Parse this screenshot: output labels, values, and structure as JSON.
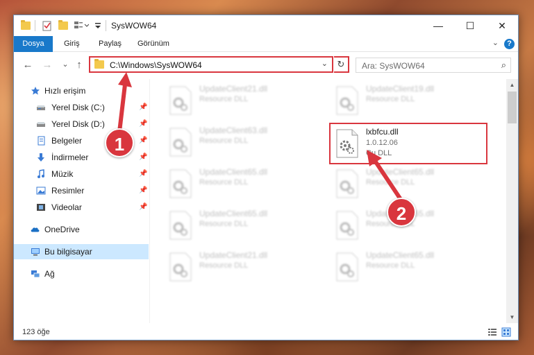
{
  "window": {
    "title": "SysWOW64",
    "minimize_glyph": "—",
    "maximize_glyph": "☐",
    "close_glyph": "✕"
  },
  "ribbon": {
    "tabs": [
      "Dosya",
      "Giriş",
      "Paylaş",
      "Görünüm"
    ],
    "help_glyph": "?",
    "expand_glyph": "⌄"
  },
  "nav": {
    "back_glyph": "←",
    "forward_glyph": "→",
    "recent_glyph": "⌄",
    "up_glyph": "↑",
    "address_path": "C:\\Windows\\SysWOW64",
    "address_dropdown_glyph": "⌄",
    "refresh_glyph": "↻",
    "search_placeholder": "Ara: SysWOW64",
    "search_glyph": "⌕"
  },
  "sidebar": {
    "pin_glyph": "📌",
    "items": [
      {
        "label": "Hızlı erişim",
        "icon": "star-icon"
      },
      {
        "label": "Yerel Disk (C:)",
        "icon": "drive-icon",
        "pinned": true
      },
      {
        "label": "Yerel Disk (D:)",
        "icon": "drive-icon",
        "pinned": true
      },
      {
        "label": "Belgeler",
        "icon": "documents-icon",
        "pinned": true
      },
      {
        "label": "İndirmeler",
        "icon": "download-icon",
        "pinned": true
      },
      {
        "label": "Müzik",
        "icon": "music-icon",
        "pinned": true
      },
      {
        "label": "Resimler",
        "icon": "pictures-icon",
        "pinned": true
      },
      {
        "label": "Videolar",
        "icon": "videos-icon",
        "pinned": true
      },
      {
        "label": "OneDrive",
        "icon": "cloud-icon"
      },
      {
        "label": "Bu bilgisayar",
        "icon": "computer-icon",
        "selected": true
      },
      {
        "label": "Ağ",
        "icon": "network-icon"
      }
    ]
  },
  "files": {
    "left_column": [
      {
        "name": "UpdateClient21.dll",
        "type": "Resource DLL"
      },
      {
        "name": "UpdateClient63.dll",
        "type": "Resource DLL"
      },
      {
        "name": "UpdateClient65.dll",
        "type": "Resource DLL"
      },
      {
        "name": "UpdateClient65.dll",
        "type": "Resource DLL"
      },
      {
        "name": "UpdateClient21.dll",
        "type": "Resource DLL"
      }
    ],
    "right_column": [
      {
        "name": "UpdateClient19.dll",
        "type": "Resource DLL"
      },
      {
        "name": "UpdateClient65.dll",
        "type": "Resource DLL"
      },
      {
        "name": "UpdateClient65.dll",
        "type": "Resource DLL"
      },
      {
        "name": "UpdateClient65.dll",
        "type": "Resource DLL"
      }
    ],
    "highlighted": {
      "name": "lxbfcu.dll",
      "version": "1.0.12.06",
      "type": "Cu DLL"
    }
  },
  "status": {
    "item_count": "123 öğe"
  },
  "annotations": {
    "badge1": "1",
    "badge2": "2",
    "color": "#d9363e"
  },
  "scrollbar": {
    "up_glyph": "▲",
    "down_glyph": "▼"
  }
}
